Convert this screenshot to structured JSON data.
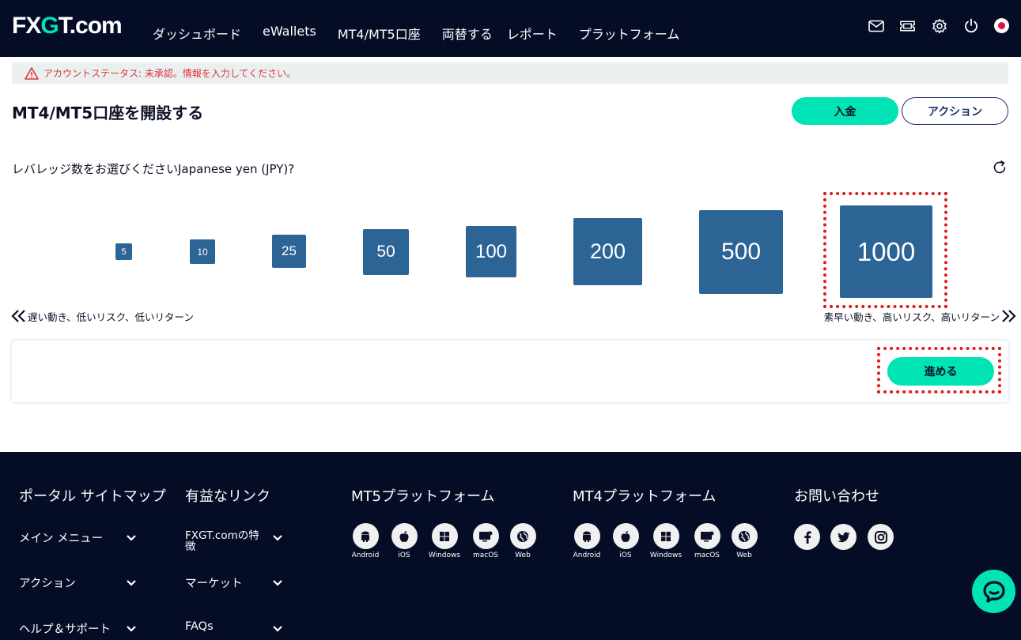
{
  "header": {
    "logo_fx": "FX",
    "logo_g": "G",
    "logo_rest": "T.com",
    "nav": [
      "ダッシュボード",
      "eWallets",
      "MT4/MT5口座",
      "両替する",
      "レポート",
      "プラットフォーム"
    ],
    "icons": [
      "mail-icon",
      "ticket-icon",
      "gear-icon",
      "power-icon",
      "japan-flag-icon"
    ]
  },
  "alert": {
    "text": "アカウントステータス: 未承認。情報を入力してください。"
  },
  "page": {
    "title": "MT4/MT5口座を開設する",
    "deposit_label": "入金",
    "action_label": "アクション"
  },
  "leverage": {
    "question": "レバレッジ数をお選びくださいJapanese yen (JPY)?",
    "options": [
      "5",
      "10",
      "25",
      "50",
      "100",
      "200",
      "500",
      "1000"
    ],
    "selected": "1000",
    "low_risk_label": "遅い動き、低いリスク、低いリターン",
    "high_risk_label": "素早い動き、高いリスク、高いリターン"
  },
  "proceed_label": "進める",
  "footer": {
    "portal_title": "ポータル サイトマップ",
    "portal_items": [
      "メイン メニュー",
      "アクション",
      "ヘルプ＆サポート"
    ],
    "links_title": "有益なリンク",
    "links_items": [
      "FXGT.comの特徴",
      "マーケット",
      "FAQs"
    ],
    "mt5_title": "MT5プラットフォーム",
    "mt4_title": "MT4プラットフォーム",
    "platforms": [
      "Android",
      "iOS",
      "Windows",
      "macOS",
      "Web"
    ],
    "contact_title": "お問い合わせ",
    "social": [
      "facebook-icon",
      "twitter-icon",
      "instagram-icon"
    ]
  },
  "colors": {
    "navy": "#050c26",
    "accent": "#00e3b5",
    "tile": "#2d6496",
    "highlight": "#e01a1a"
  }
}
